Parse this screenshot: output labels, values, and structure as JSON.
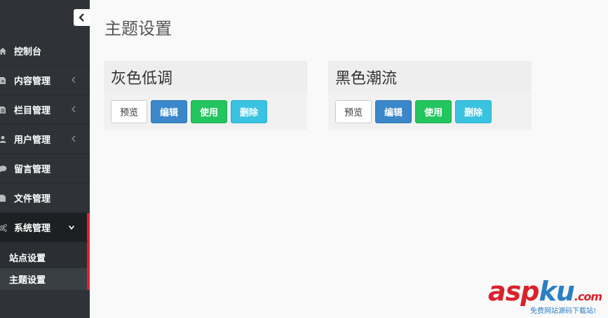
{
  "page": {
    "title": "主题设置"
  },
  "sidebar": {
    "collapse_icon": "chevron-left-icon",
    "items": [
      {
        "label": "控制台",
        "icon": "home-icon",
        "has_arrow": false
      },
      {
        "label": "内容管理",
        "icon": "file-icon",
        "has_arrow": true
      },
      {
        "label": "栏目管理",
        "icon": "list-icon",
        "has_arrow": true
      },
      {
        "label": "用户管理",
        "icon": "user-icon",
        "has_arrow": true
      },
      {
        "label": "留言管理",
        "icon": "comment-icon",
        "has_arrow": false
      },
      {
        "label": "文件管理",
        "icon": "document-icon",
        "has_arrow": false
      },
      {
        "label": "系统管理",
        "icon": "cogs-icon",
        "has_arrow": true,
        "expanded": true
      }
    ],
    "submenu": [
      {
        "label": "站点设置"
      },
      {
        "label": "主题设置",
        "active": true
      }
    ],
    "accent_color": "#e8202a"
  },
  "themes": [
    {
      "name": "灰色低调",
      "buttons": {
        "preview": "预览",
        "edit": "编辑",
        "use": "使用",
        "delete": "删除"
      }
    },
    {
      "name": "黑色潮流",
      "buttons": {
        "preview": "预览",
        "edit": "编辑",
        "use": "使用",
        "delete": "删除"
      }
    }
  ],
  "colors": {
    "edit": "#3a87c9",
    "use": "#22c55e",
    "delete": "#39c3e0",
    "sidebar_bg": "#2f3337"
  },
  "watermark": {
    "main": "aspku",
    "dot": ".com",
    "sub": "免费网站源码下载站!"
  }
}
